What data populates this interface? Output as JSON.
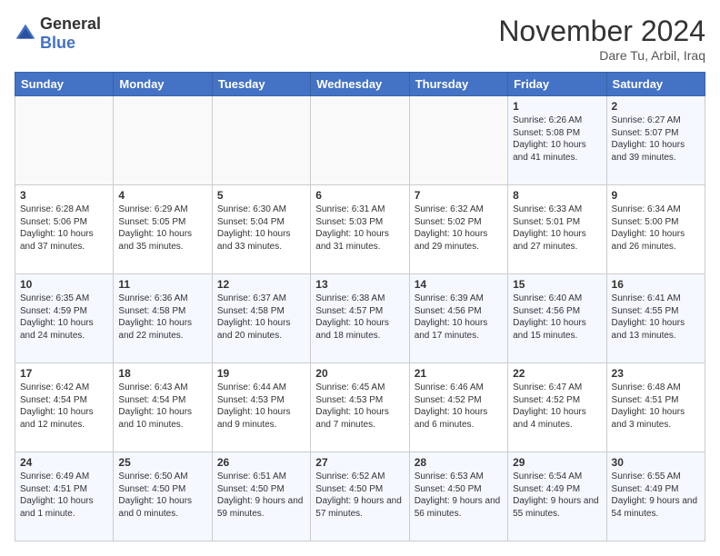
{
  "header": {
    "logo_general": "General",
    "logo_blue": "Blue",
    "title": "November 2024",
    "location": "Dare Tu, Arbil, Iraq"
  },
  "weekdays": [
    "Sunday",
    "Monday",
    "Tuesday",
    "Wednesday",
    "Thursday",
    "Friday",
    "Saturday"
  ],
  "weeks": [
    [
      {
        "day": "",
        "info": ""
      },
      {
        "day": "",
        "info": ""
      },
      {
        "day": "",
        "info": ""
      },
      {
        "day": "",
        "info": ""
      },
      {
        "day": "",
        "info": ""
      },
      {
        "day": "1",
        "info": "Sunrise: 6:26 AM\nSunset: 5:08 PM\nDaylight: 10 hours and 41 minutes."
      },
      {
        "day": "2",
        "info": "Sunrise: 6:27 AM\nSunset: 5:07 PM\nDaylight: 10 hours and 39 minutes."
      }
    ],
    [
      {
        "day": "3",
        "info": "Sunrise: 6:28 AM\nSunset: 5:06 PM\nDaylight: 10 hours and 37 minutes."
      },
      {
        "day": "4",
        "info": "Sunrise: 6:29 AM\nSunset: 5:05 PM\nDaylight: 10 hours and 35 minutes."
      },
      {
        "day": "5",
        "info": "Sunrise: 6:30 AM\nSunset: 5:04 PM\nDaylight: 10 hours and 33 minutes."
      },
      {
        "day": "6",
        "info": "Sunrise: 6:31 AM\nSunset: 5:03 PM\nDaylight: 10 hours and 31 minutes."
      },
      {
        "day": "7",
        "info": "Sunrise: 6:32 AM\nSunset: 5:02 PM\nDaylight: 10 hours and 29 minutes."
      },
      {
        "day": "8",
        "info": "Sunrise: 6:33 AM\nSunset: 5:01 PM\nDaylight: 10 hours and 27 minutes."
      },
      {
        "day": "9",
        "info": "Sunrise: 6:34 AM\nSunset: 5:00 PM\nDaylight: 10 hours and 26 minutes."
      }
    ],
    [
      {
        "day": "10",
        "info": "Sunrise: 6:35 AM\nSunset: 4:59 PM\nDaylight: 10 hours and 24 minutes."
      },
      {
        "day": "11",
        "info": "Sunrise: 6:36 AM\nSunset: 4:58 PM\nDaylight: 10 hours and 22 minutes."
      },
      {
        "day": "12",
        "info": "Sunrise: 6:37 AM\nSunset: 4:58 PM\nDaylight: 10 hours and 20 minutes."
      },
      {
        "day": "13",
        "info": "Sunrise: 6:38 AM\nSunset: 4:57 PM\nDaylight: 10 hours and 18 minutes."
      },
      {
        "day": "14",
        "info": "Sunrise: 6:39 AM\nSunset: 4:56 PM\nDaylight: 10 hours and 17 minutes."
      },
      {
        "day": "15",
        "info": "Sunrise: 6:40 AM\nSunset: 4:56 PM\nDaylight: 10 hours and 15 minutes."
      },
      {
        "day": "16",
        "info": "Sunrise: 6:41 AM\nSunset: 4:55 PM\nDaylight: 10 hours and 13 minutes."
      }
    ],
    [
      {
        "day": "17",
        "info": "Sunrise: 6:42 AM\nSunset: 4:54 PM\nDaylight: 10 hours and 12 minutes."
      },
      {
        "day": "18",
        "info": "Sunrise: 6:43 AM\nSunset: 4:54 PM\nDaylight: 10 hours and 10 minutes."
      },
      {
        "day": "19",
        "info": "Sunrise: 6:44 AM\nSunset: 4:53 PM\nDaylight: 10 hours and 9 minutes."
      },
      {
        "day": "20",
        "info": "Sunrise: 6:45 AM\nSunset: 4:53 PM\nDaylight: 10 hours and 7 minutes."
      },
      {
        "day": "21",
        "info": "Sunrise: 6:46 AM\nSunset: 4:52 PM\nDaylight: 10 hours and 6 minutes."
      },
      {
        "day": "22",
        "info": "Sunrise: 6:47 AM\nSunset: 4:52 PM\nDaylight: 10 hours and 4 minutes."
      },
      {
        "day": "23",
        "info": "Sunrise: 6:48 AM\nSunset: 4:51 PM\nDaylight: 10 hours and 3 minutes."
      }
    ],
    [
      {
        "day": "24",
        "info": "Sunrise: 6:49 AM\nSunset: 4:51 PM\nDaylight: 10 hours and 1 minute."
      },
      {
        "day": "25",
        "info": "Sunrise: 6:50 AM\nSunset: 4:50 PM\nDaylight: 10 hours and 0 minutes."
      },
      {
        "day": "26",
        "info": "Sunrise: 6:51 AM\nSunset: 4:50 PM\nDaylight: 9 hours and 59 minutes."
      },
      {
        "day": "27",
        "info": "Sunrise: 6:52 AM\nSunset: 4:50 PM\nDaylight: 9 hours and 57 minutes."
      },
      {
        "day": "28",
        "info": "Sunrise: 6:53 AM\nSunset: 4:50 PM\nDaylight: 9 hours and 56 minutes."
      },
      {
        "day": "29",
        "info": "Sunrise: 6:54 AM\nSunset: 4:49 PM\nDaylight: 9 hours and 55 minutes."
      },
      {
        "day": "30",
        "info": "Sunrise: 6:55 AM\nSunset: 4:49 PM\nDaylight: 9 hours and 54 minutes."
      }
    ]
  ]
}
